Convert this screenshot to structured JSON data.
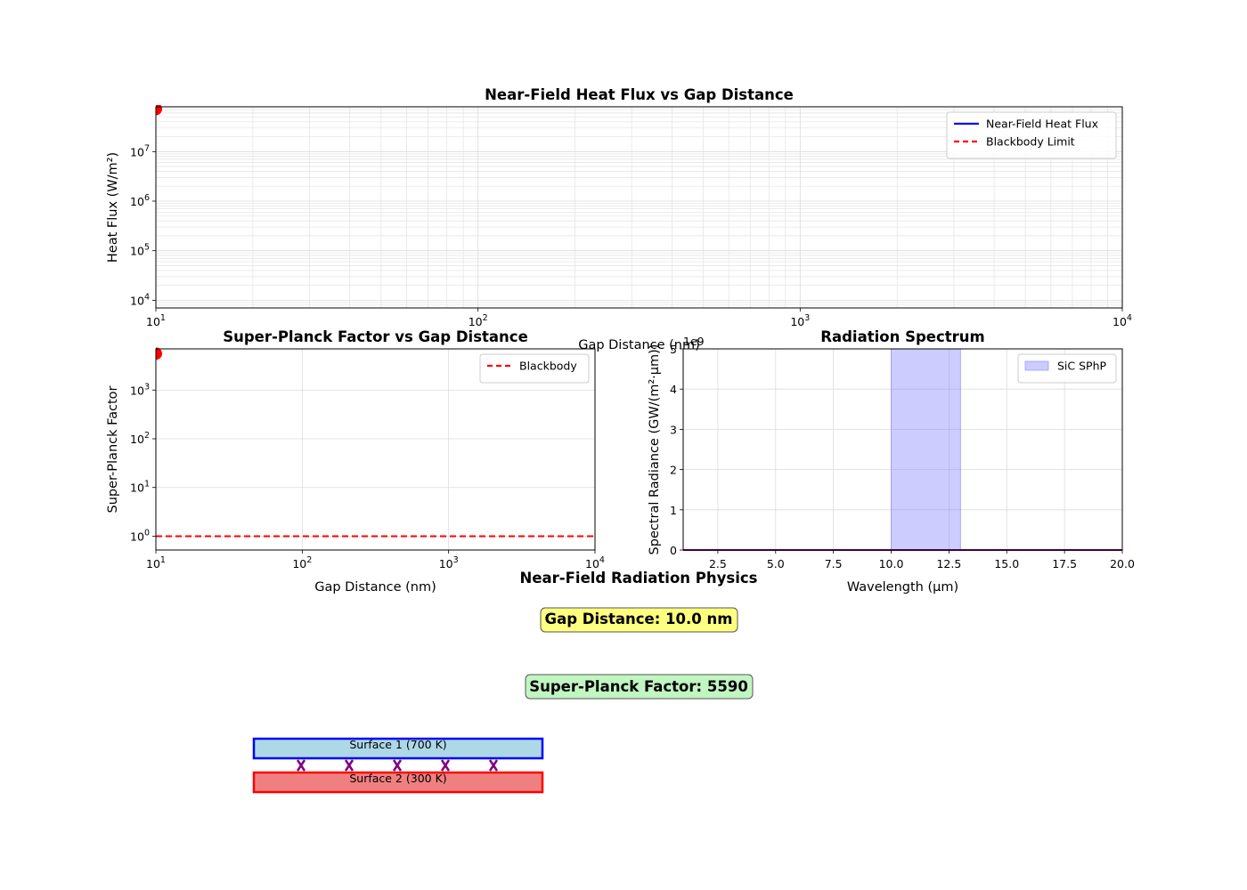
{
  "chart_data": [
    {
      "type": "line",
      "title": "Near-Field Heat Flux vs Gap Distance",
      "xlabel": "Gap Distance (nm)",
      "ylabel": "Heat Flux (W/m²)",
      "xscale": "log",
      "yscale": "log",
      "xlim": [
        10,
        10000
      ],
      "ylim": [
        7000,
        80000000
      ],
      "xticks": [
        10,
        100,
        1000,
        10000
      ],
      "xtick_labels": [
        {
          "base": "10",
          "exp": "1"
        },
        {
          "base": "10",
          "exp": "2"
        },
        {
          "base": "10",
          "exp": "3"
        },
        {
          "base": "10",
          "exp": "4"
        }
      ],
      "yticks": [
        10000,
        100000,
        1000000,
        10000000
      ],
      "ytick_labels": [
        {
          "base": "10",
          "exp": "4"
        },
        {
          "base": "10",
          "exp": "5"
        },
        {
          "base": "10",
          "exp": "6"
        },
        {
          "base": "10",
          "exp": "7"
        }
      ],
      "grid": "major-and-minor",
      "legend_position": "upper-right",
      "series": [
        {
          "name": "Near-Field Heat Flux",
          "color": "#0000ff",
          "style": "solid",
          "x": [],
          "y": []
        },
        {
          "name": "Blackbody Limit",
          "color": "#ff0000",
          "style": "dashed",
          "x": [],
          "y": []
        }
      ],
      "markers": [
        {
          "x": 10,
          "y": 72000000,
          "color": "#ff0000"
        }
      ]
    },
    {
      "type": "line",
      "title": "Super-Planck Factor vs Gap Distance",
      "xlabel": "Gap Distance (nm)",
      "ylabel": "Super-Planck Factor",
      "xscale": "log",
      "yscale": "log",
      "xlim": [
        10,
        10000
      ],
      "ylim": [
        0.52,
        7000
      ],
      "xticks": [
        10,
        100,
        1000,
        10000
      ],
      "xtick_labels": [
        {
          "base": "10",
          "exp": "1"
        },
        {
          "base": "10",
          "exp": "2"
        },
        {
          "base": "10",
          "exp": "3"
        },
        {
          "base": "10",
          "exp": "4"
        }
      ],
      "yticks": [
        1,
        10,
        100,
        1000
      ],
      "ytick_labels": [
        {
          "base": "10",
          "exp": "0"
        },
        {
          "base": "10",
          "exp": "1"
        },
        {
          "base": "10",
          "exp": "2"
        },
        {
          "base": "10",
          "exp": "3"
        }
      ],
      "grid": "major",
      "legend_position": "upper-right",
      "series": [
        {
          "name": "Blackbody",
          "color": "#ff0000",
          "style": "dashed",
          "x": [
            10,
            10000
          ],
          "y": [
            1,
            1
          ]
        }
      ],
      "markers": [
        {
          "x": 10,
          "y": 5590,
          "color": "#ff0000"
        }
      ]
    },
    {
      "type": "area",
      "title": "Radiation Spectrum",
      "xlabel": "Wavelength (μm)",
      "ylabel": "Spectral Radiance (GW/(m²·μm))",
      "offset_text": "1e9",
      "xlim": [
        1,
        20
      ],
      "ylim": [
        0,
        5
      ],
      "xticks": [
        2.5,
        5.0,
        7.5,
        10.0,
        12.5,
        15.0,
        17.5,
        20.0
      ],
      "xtick_labels": [
        "2.5",
        "5.0",
        "7.5",
        "10.0",
        "12.5",
        "15.0",
        "17.5",
        "20.0"
      ],
      "yticks": [
        0,
        1,
        2,
        3,
        4,
        5
      ],
      "ytick_labels": [
        "0",
        "1",
        "2",
        "3",
        "4",
        "5"
      ],
      "grid": "major",
      "legend_position": "upper-right",
      "band": {
        "name": "SiC SPhP",
        "x0": 10.0,
        "x1": 13.0,
        "color": "#8080ff"
      },
      "series": [
        {
          "name": "",
          "color": "#800080",
          "style": "solid",
          "x": [
            1,
            20
          ],
          "y": [
            0,
            0
          ]
        }
      ]
    }
  ],
  "panel": {
    "title": "Near-Field Radiation Physics",
    "gap_label": "Gap Distance: 10.0 nm",
    "spf_label": "Super-Planck Factor: 5590",
    "surface1_label": "Surface 1 (700 K)",
    "surface2_label": "Surface 2 (300 K)",
    "arrow_count": 5,
    "colors": {
      "gap_box": "#ffff80",
      "spf_box": "#c1f5c1",
      "surface1_fill": "#add8e6",
      "surface1_edge": "#0000ff",
      "surface2_fill": "#f08080",
      "surface2_edge": "#ff0000",
      "arrow": "#800080"
    }
  }
}
